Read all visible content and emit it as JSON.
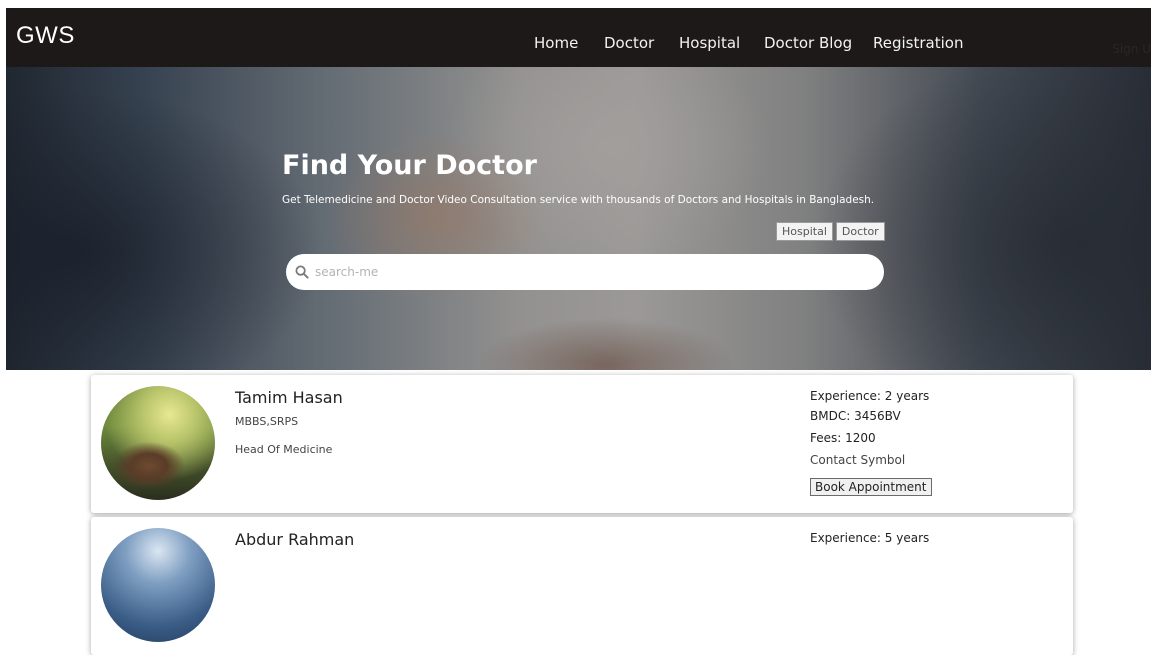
{
  "navbar": {
    "brand": "GWS",
    "items": [
      {
        "label": "Home"
      },
      {
        "label": "Doctor"
      },
      {
        "label": "Hospital"
      },
      {
        "label": "Doctor Blog"
      },
      {
        "label": "Registration"
      }
    ],
    "signin_label": "Sign U"
  },
  "hero": {
    "title": "Find Your Doctor",
    "subtitle": "Get Telemedicine and Doctor Video Consultation service with thousands of Doctors and Hospitals in Bangladesh.",
    "tabs": [
      {
        "label": "Hospital"
      },
      {
        "label": "Doctor"
      }
    ],
    "search": {
      "placeholder": "search-me",
      "value": "",
      "icon": "search-icon"
    }
  },
  "doctors": [
    {
      "name": "Tamim Hasan",
      "degree": "MBBS,SRPS",
      "position": "Head Of Medicine",
      "experience": "Experience: 2 years",
      "bmdc": "BMDC: 3456BV",
      "fees": "Fees: 1200",
      "contact": "Contact Symbol",
      "book_label": "Book Appointment"
    },
    {
      "name": "Abdur Rahman",
      "experience": "Experience: 5 years"
    }
  ]
}
